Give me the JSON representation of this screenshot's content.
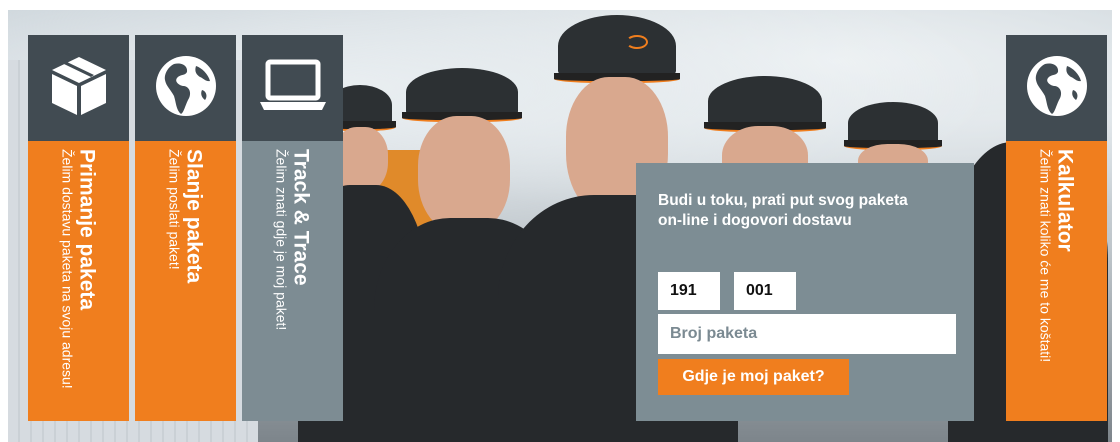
{
  "tiles": [
    {
      "title": "Primanje paketa",
      "subtitle": "Želim dostavu paketa na svoju adresu!",
      "icon": "box-icon",
      "color": "#f07e1e"
    },
    {
      "title": "Slanje paketa",
      "subtitle": "Želim poslati paket!",
      "icon": "globe-icon",
      "color": "#f07e1e"
    },
    {
      "title": "Track & Trace",
      "subtitle": "Želim znati gdje je moj paket!",
      "icon": "laptop-icon",
      "color": "#7d8c93"
    },
    {
      "title": "Kalkulator",
      "subtitle": "Želim znati koliko će me to koštati!",
      "icon": "globe-icon",
      "color": "#f07e1e"
    }
  ],
  "tracking": {
    "heading": "Budi u toku, prati put svog paketa on-line i dogovori dostavu",
    "prefix1": "191",
    "prefix2": "001",
    "parcel_placeholder": "Broj paketa",
    "button_label": "Gdje je moj paket?"
  },
  "colors": {
    "accent": "#f07e1e",
    "icon_bg": "#414b52",
    "panel": "#7d8d94"
  }
}
